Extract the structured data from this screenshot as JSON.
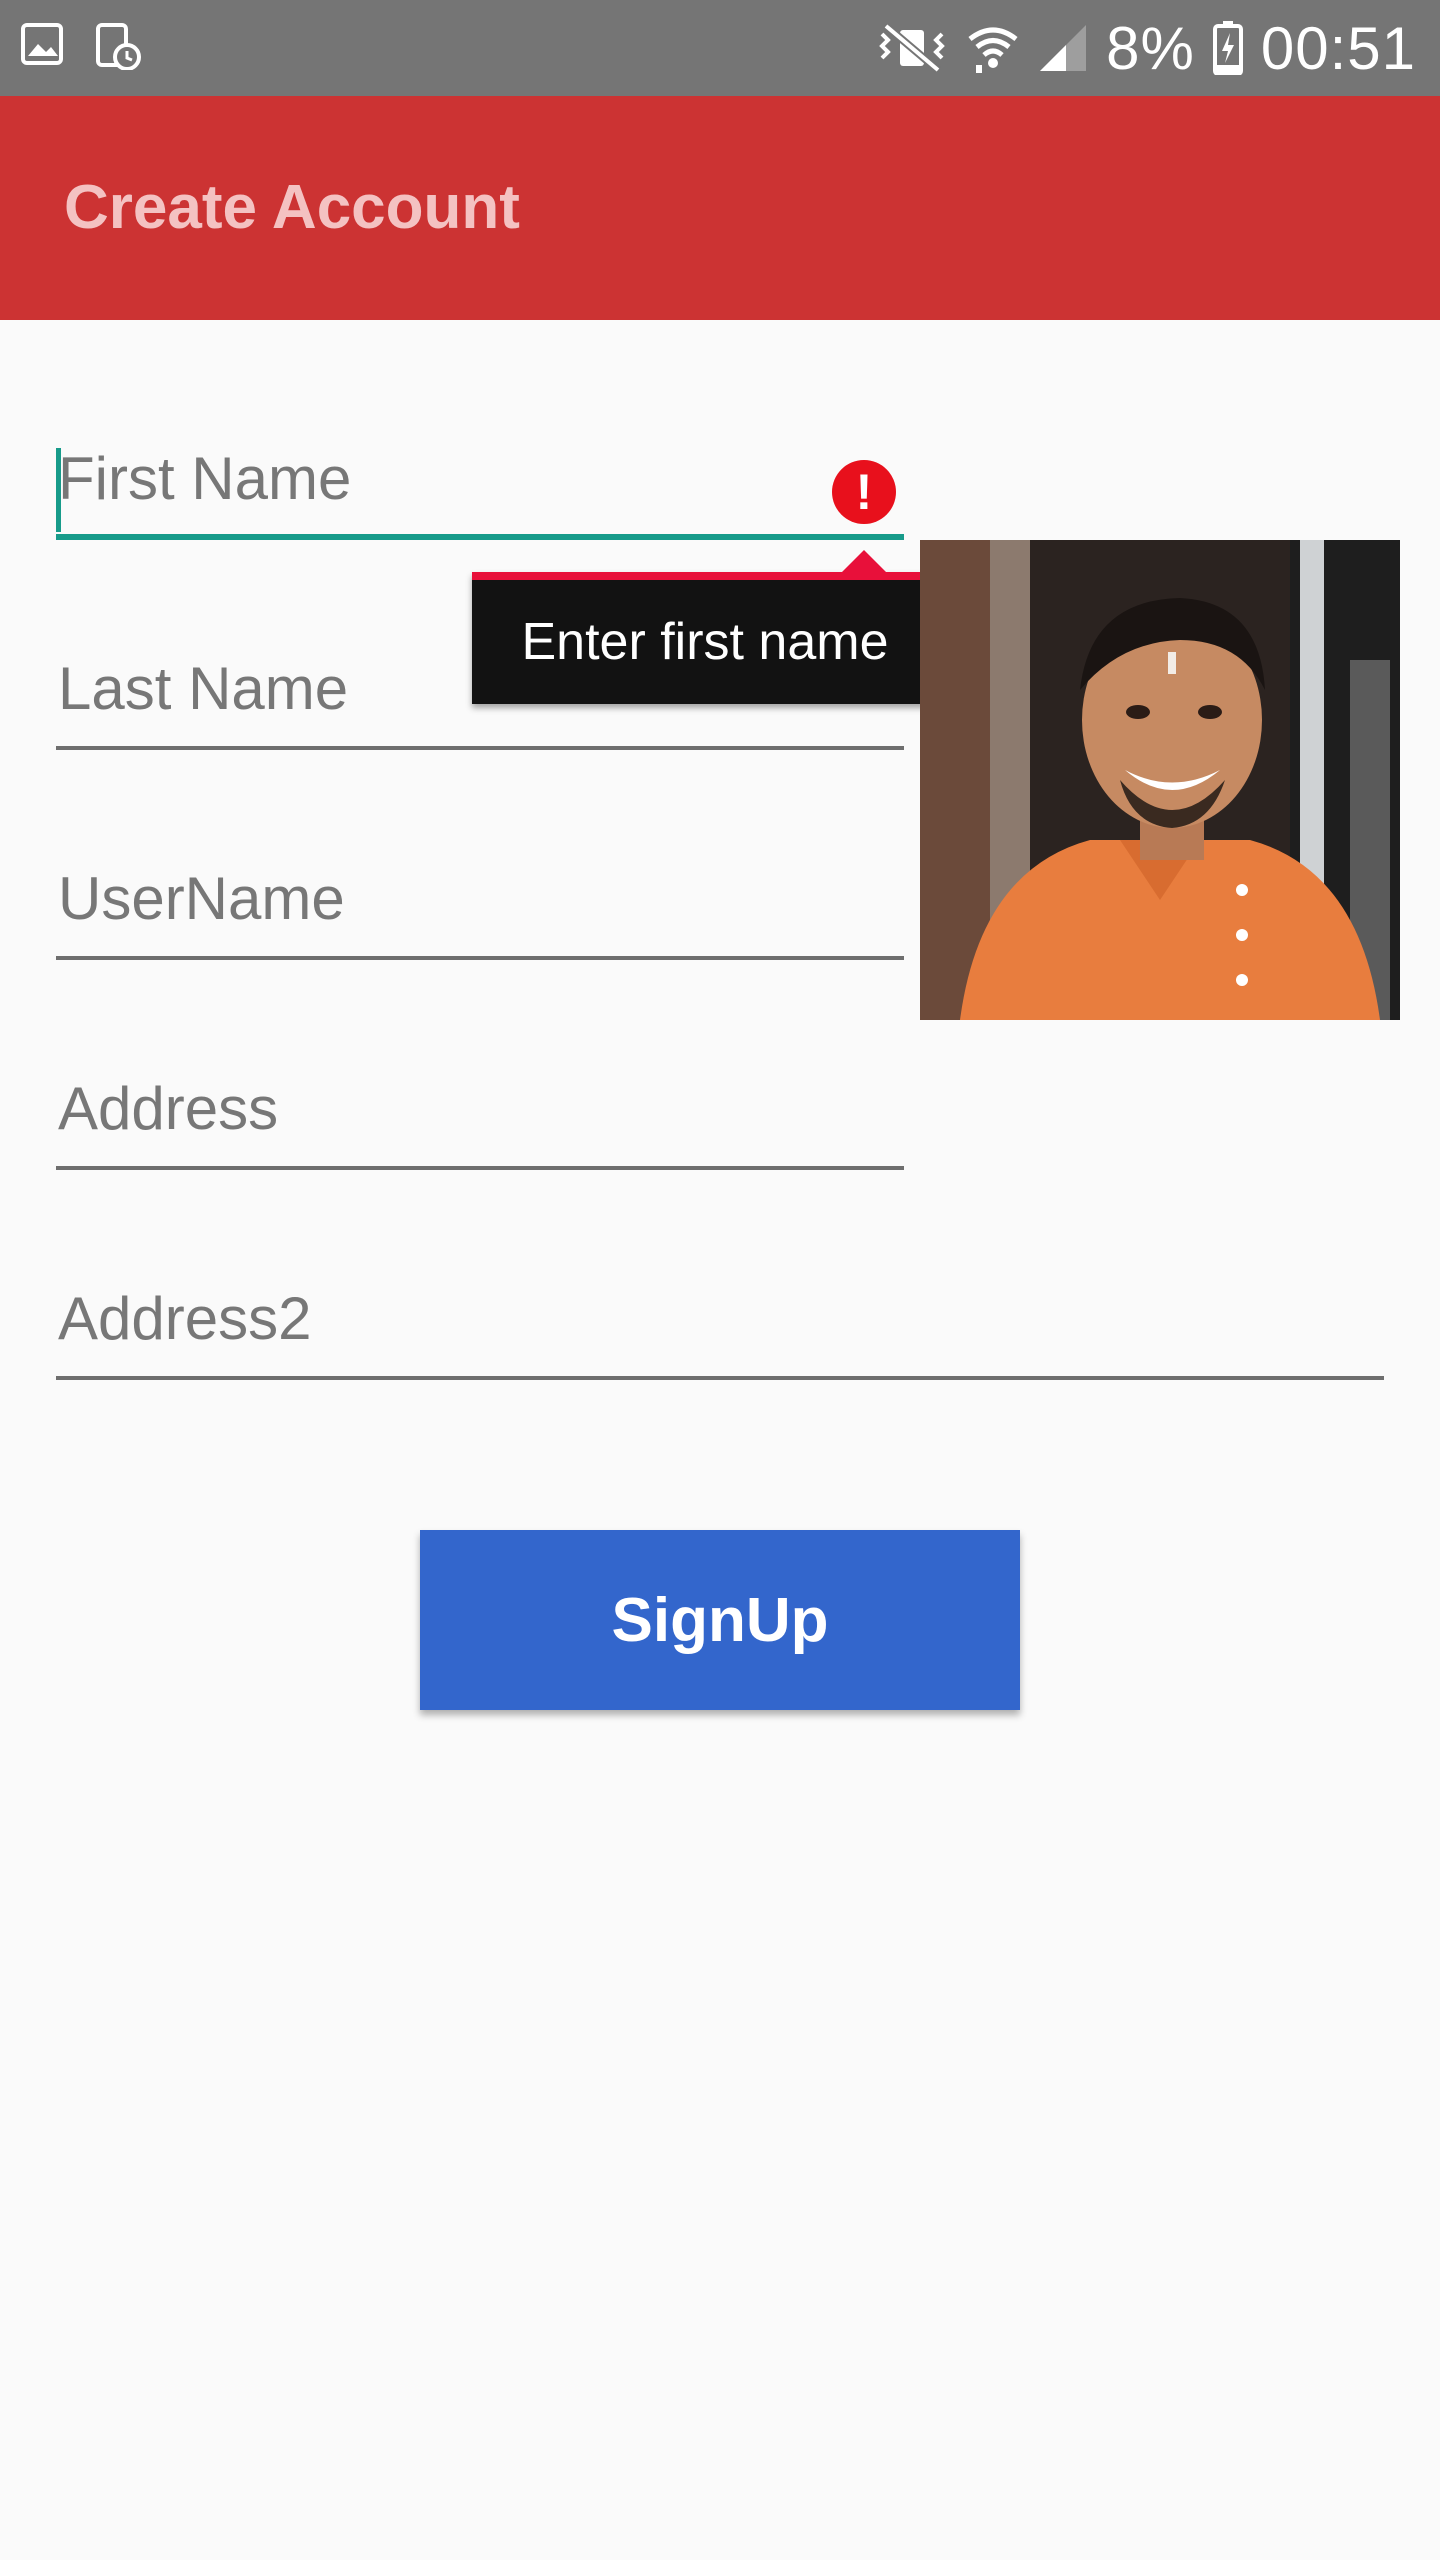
{
  "status_bar": {
    "icons_left": [
      "gallery-icon",
      "screenshot-icon"
    ],
    "icons_right": [
      "vibrate-icon",
      "wifi-icon",
      "signal-icon",
      "battery-charging-icon"
    ],
    "battery": "8%",
    "time": "00:51"
  },
  "app_bar": {
    "title": "Create Account",
    "background_color": "#cc3333"
  },
  "form": {
    "first_name": {
      "placeholder": "First Name",
      "value": "",
      "error": "Enter first name"
    },
    "last_name": {
      "placeholder": "Last Name",
      "value": ""
    },
    "username": {
      "placeholder": "UserName",
      "value": ""
    },
    "address": {
      "placeholder": "Address",
      "value": ""
    },
    "address2": {
      "placeholder": "Address2",
      "value": ""
    }
  },
  "signup_button": {
    "label": "SignUp",
    "color": "#3366cc"
  },
  "colors": {
    "accent": "#179b8a",
    "error": "#e8101c"
  }
}
